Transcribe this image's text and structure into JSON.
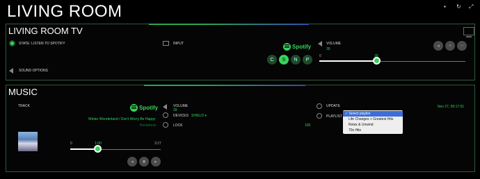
{
  "page": {
    "title": "LIVING ROOM"
  },
  "top_icons": [
    "chat-icon",
    "refresh-icon",
    "expand-icon"
  ],
  "tv": {
    "title": "LIVING ROOM TV",
    "state_label": "STATE: LISTEN TO SPOTIFY",
    "input_label": "INPUT",
    "sound_options_label": "SOUND OPTIONS",
    "volume_label": "VOLUME",
    "volume_value": "39",
    "slider_min": "0",
    "slider_value": "39",
    "slider_fraction": 0.39,
    "spotify_label": "Spotify",
    "source_buttons": [
      "C",
      "S",
      "N",
      "P"
    ]
  },
  "music": {
    "title": "MUSIC",
    "track_label": "TRACK",
    "spotify_label": "Spotify",
    "track_title": "Winter Wonderland / Don't Worry Be Happy",
    "artist": "Pentatonix",
    "volume_label": "VOLUME",
    "volume_value": "39",
    "devices_label": "DEVICES",
    "device_value": "SHIELD",
    "lock_label": "LOCK",
    "lock_value": "100",
    "update_label": "UPDATE",
    "update_value": "Nov 27, 09:17:01",
    "playlist_label": "PLAYLIST",
    "playlist_options": [
      "Select playlist",
      "Life Changes + Greatest Hits",
      "Relax & Unwind",
      "70s Hits"
    ],
    "playlist_selected_check": "✓",
    "progress_start": "0",
    "progress_current": "1:00",
    "progress_end": "3:27",
    "progress_fraction": 0.29
  },
  "colors": {
    "accent": "#37d45a",
    "border": "#2f5a3a",
    "bar_blue": "#2f4ea8"
  }
}
